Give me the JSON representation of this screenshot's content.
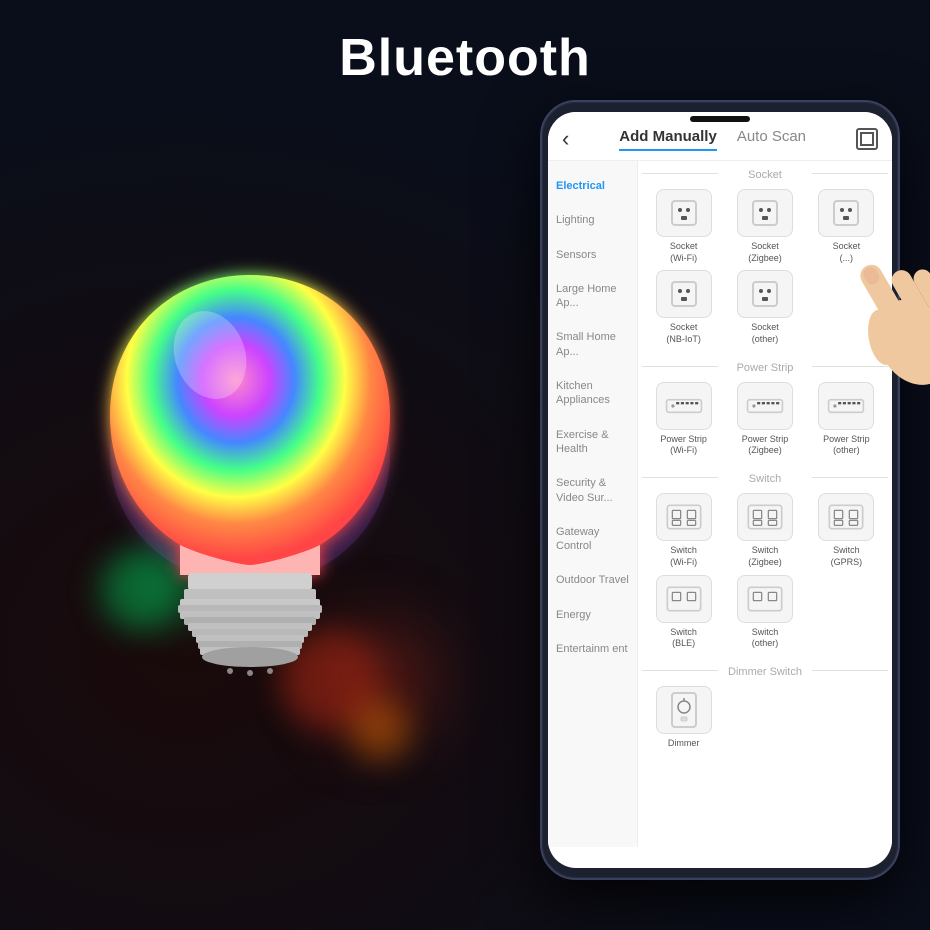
{
  "title": "Bluetooth",
  "header": {
    "back_label": "‹",
    "tab_add_manually": "Add Manually",
    "tab_auto_scan": "Auto Scan"
  },
  "nav_items": [
    {
      "label": "Electrical",
      "active": true
    },
    {
      "label": "Lighting"
    },
    {
      "label": "Sensors"
    },
    {
      "label": "Large Home Ap..."
    },
    {
      "label": "Small Home Ap..."
    },
    {
      "label": "Kitchen Appliances"
    },
    {
      "label": "Exercise & Health"
    },
    {
      "label": "Security & Video Sur..."
    },
    {
      "label": "Gateway Control"
    },
    {
      "label": "Outdoor Travel"
    },
    {
      "label": "Energy"
    },
    {
      "label": "Entertainm ent"
    }
  ],
  "sections": [
    {
      "label": "Socket",
      "devices": [
        {
          "label": "Socket\n(Wi-Fi)",
          "type": "socket"
        },
        {
          "label": "Socket\n(Zigbee)",
          "type": "socket"
        },
        {
          "label": "Socket\n(...)",
          "type": "socket"
        },
        {
          "label": "Socket\n(NB-IoT)",
          "type": "socket"
        },
        {
          "label": "Socket\n(other)",
          "type": "socket"
        }
      ]
    },
    {
      "label": "Power Strip",
      "devices": [
        {
          "label": "Power Strip\n(Wi-Fi)",
          "type": "strip"
        },
        {
          "label": "Power Strip\n(Zigbee)",
          "type": "strip"
        },
        {
          "label": "Power Strip\n(other)",
          "type": "strip"
        }
      ]
    },
    {
      "label": "Switch",
      "devices": [
        {
          "label": "Switch\n(Wi-Fi)",
          "type": "switch"
        },
        {
          "label": "Switch\n(Zigbee)",
          "type": "switch"
        },
        {
          "label": "Switch\n(GPRS)",
          "type": "switch"
        },
        {
          "label": "Switch\n(BLE)",
          "type": "switch"
        },
        {
          "label": "Switch\n(other)",
          "type": "switch"
        }
      ]
    },
    {
      "label": "Dimmer Switch",
      "devices": [
        {
          "label": "Dimmer",
          "type": "dimmer"
        }
      ]
    }
  ]
}
